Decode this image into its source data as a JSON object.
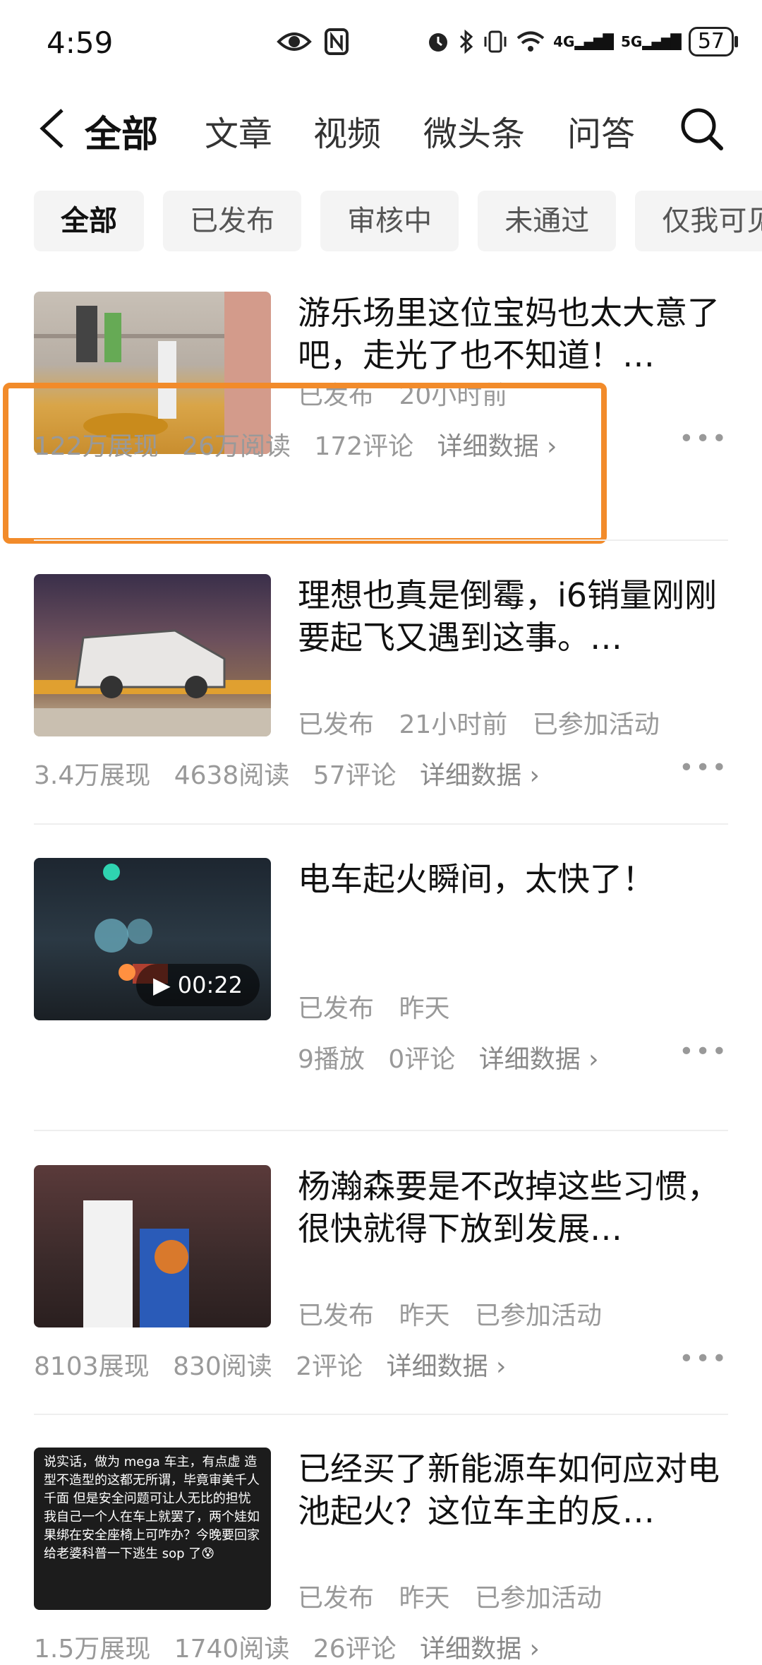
{
  "status_bar": {
    "time": "4:59",
    "battery": "57",
    "icons": [
      "eye-icon",
      "nfc-icon",
      "alarm-icon",
      "bluetooth-icon",
      "vibrate-icon",
      "wifi-icon",
      "signal-4g-icon",
      "signal-5g-icon"
    ],
    "net1": "4G",
    "net2": "5G"
  },
  "nav": {
    "tabs": [
      {
        "label": "全部"
      },
      {
        "label": "文章"
      },
      {
        "label": "视频"
      },
      {
        "label": "微头条"
      },
      {
        "label": "问答"
      }
    ]
  },
  "filters": [
    {
      "label": "全部"
    },
    {
      "label": "已发布"
    },
    {
      "label": "审核中"
    },
    {
      "label": "未通过"
    },
    {
      "label": "仅我可见"
    }
  ],
  "articles": [
    {
      "title": "游乐场里这位宝妈也太大意了吧，走光了也不知道！…",
      "status": "已发布",
      "time": "20小时前",
      "activity": "",
      "impressions": "122万展现",
      "reads": "26万阅读",
      "comments": "172评论",
      "detail": "详细数据 ›"
    },
    {
      "title": "理想也真是倒霉，i6销量刚刚要起飞又遇到这事。…",
      "status": "已发布",
      "time": "21小时前",
      "activity": "已参加活动",
      "impressions": "3.4万展现",
      "reads": "4638阅读",
      "comments": "57评论",
      "detail": "详细数据 ›"
    },
    {
      "title": "电车起火瞬间，太快了！",
      "status": "已发布",
      "time": "昨天",
      "activity": "",
      "plays": "9播放",
      "comments": "0评论",
      "duration": "00:22",
      "detail": "详细数据 ›"
    },
    {
      "title": "杨瀚森要是不改掉这些习惯，很快就得下放到发展…",
      "status": "已发布",
      "time": "昨天",
      "activity": "已参加活动",
      "impressions": "8103展现",
      "reads": "830阅读",
      "comments": "2评论",
      "detail": "详细数据 ›"
    },
    {
      "title": "已经买了新能源车如何应对电池起火？这位车主的反…",
      "status": "已发布",
      "time": "昨天",
      "activity": "已参加活动",
      "impressions": "1.5万展现",
      "reads": "1740阅读",
      "comments": "26评论",
      "detail": "详细数据 ›",
      "thumb_text": "说实话，做为 mega 车主，有点虚 造型不造型的这都无所谓，毕竟审美千人千面 但是安全问题可让人无比的担忧 我自己一个人在车上就罢了，两个娃如果绑在安全座椅上可咋办？今晚要回家给老婆科普一下逃生 sop 了😰"
    }
  ],
  "colors": {
    "highlight": "#f28b2a",
    "muted": "#999999"
  }
}
